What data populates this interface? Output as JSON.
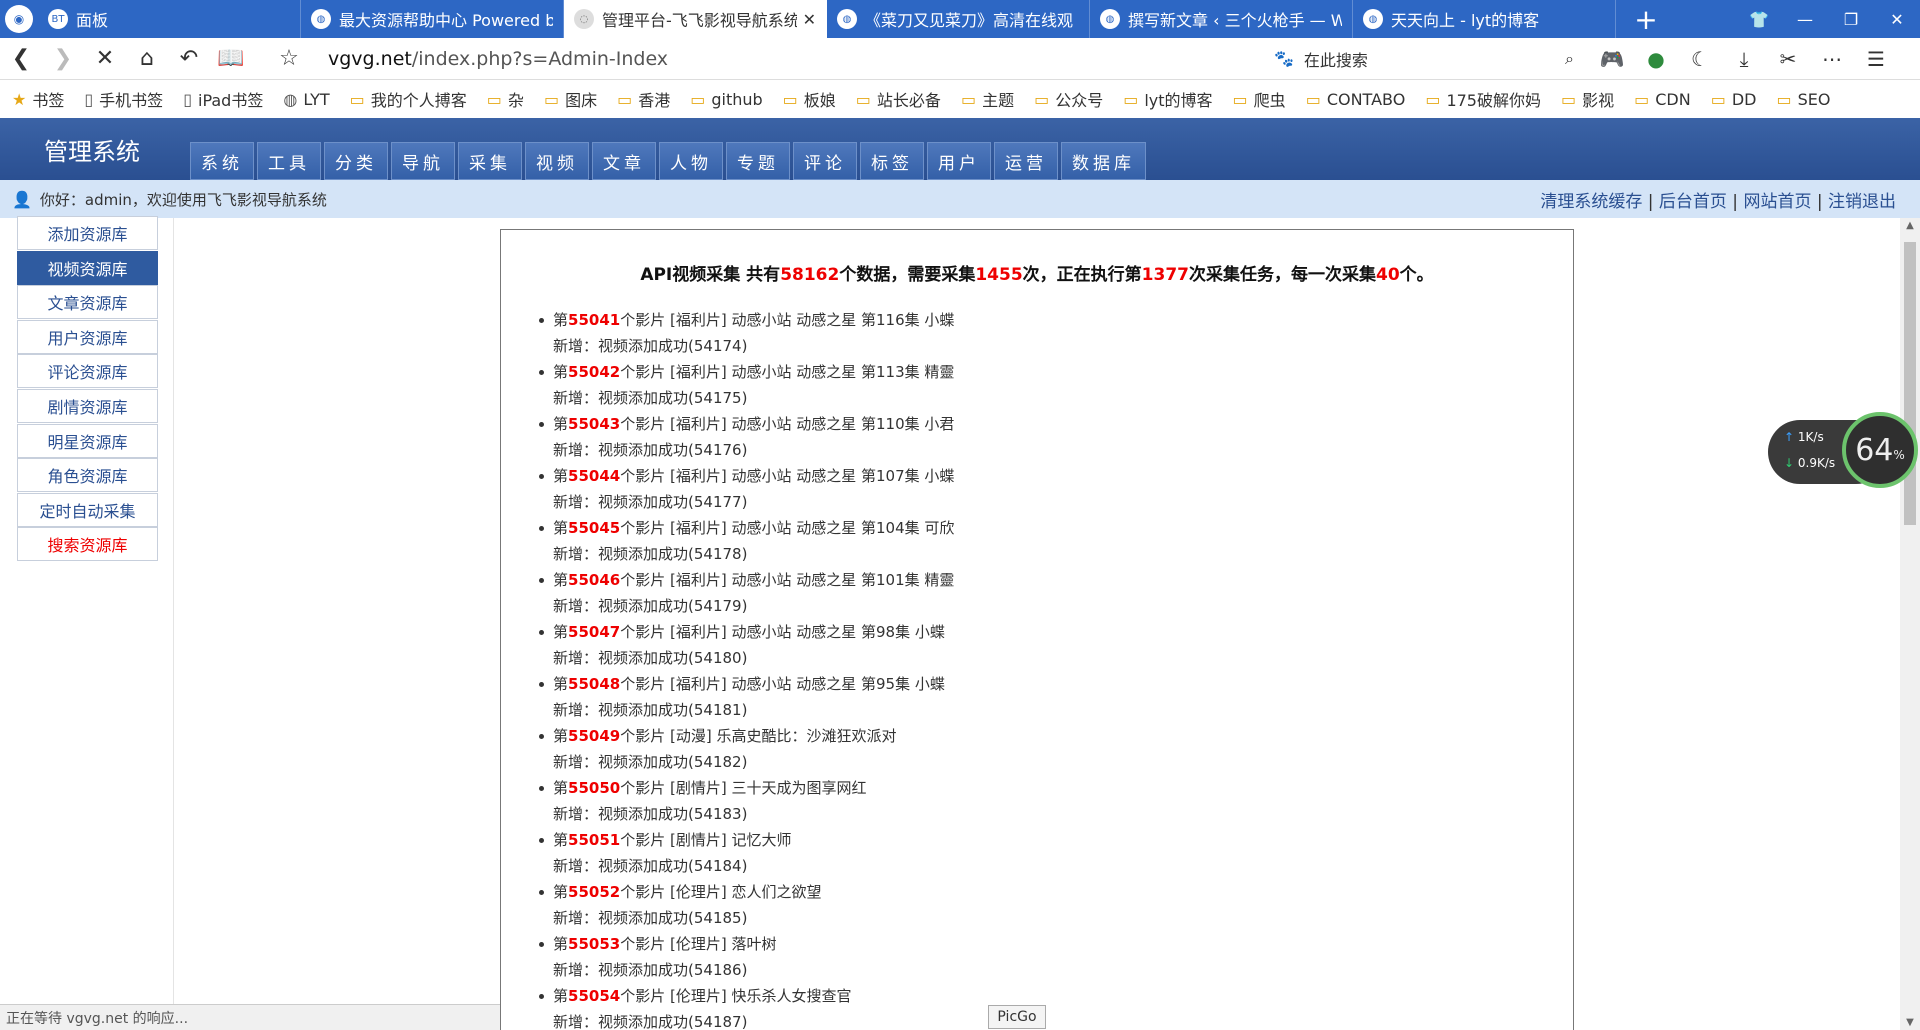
{
  "browser": {
    "tabs": [
      {
        "icon": "BT",
        "title": "面板",
        "active": false
      },
      {
        "icon": "globe-icon",
        "title": "最大资源帮助中心 Powered b",
        "active": false
      },
      {
        "icon": "loading-icon",
        "title": "管理平台-飞飞影视导航系统",
        "active": true
      },
      {
        "icon": "video-icon",
        "title": "《菜刀又见菜刀》高清在线观",
        "active": false
      },
      {
        "icon": "wordpress-icon",
        "title": "撰写新文章 ‹ 三个火枪手 — W",
        "active": false
      },
      {
        "icon": "site-icon",
        "title": "天天向上 - lyt的博客",
        "active": false
      }
    ],
    "new_tab": "+",
    "url_domain": "vgvg.net",
    "url_path": "/index.php?s=Admin-Index",
    "search_placeholder": "在此搜索",
    "bookmarks": [
      {
        "icon": "star-icon",
        "label": "书签"
      },
      {
        "icon": "phone-icon",
        "label": "手机书签"
      },
      {
        "icon": "tablet-icon",
        "label": "iPad书签"
      },
      {
        "icon": "globe-icon",
        "label": "LYT"
      },
      {
        "icon": "folder-icon",
        "label": "我的个人搏客"
      },
      {
        "icon": "folder-icon",
        "label": "杂"
      },
      {
        "icon": "folder-icon",
        "label": "图床"
      },
      {
        "icon": "folder-icon",
        "label": "香港"
      },
      {
        "icon": "folder-icon",
        "label": "github"
      },
      {
        "icon": "folder-icon",
        "label": "板娘"
      },
      {
        "icon": "folder-icon",
        "label": "站长必备"
      },
      {
        "icon": "folder-icon",
        "label": "主题"
      },
      {
        "icon": "folder-icon",
        "label": "公众号"
      },
      {
        "icon": "folder-icon",
        "label": "lyt的博客"
      },
      {
        "icon": "folder-icon",
        "label": "爬虫"
      },
      {
        "icon": "folder-icon",
        "label": "CONTABO"
      },
      {
        "icon": "folder-icon",
        "label": "175破解你妈"
      },
      {
        "icon": "folder-icon",
        "label": "影视"
      },
      {
        "icon": "folder-icon",
        "label": "CDN"
      },
      {
        "icon": "folder-icon",
        "label": "DD"
      },
      {
        "icon": "folder-icon",
        "label": "SEO"
      }
    ],
    "status_text": "正在等待 vgvg.net 的响应...",
    "picgo": "PicGo",
    "net_up": "1K/s",
    "net_down": "0.9K/s",
    "cpu_percent": "64",
    "cpu_unit": "%"
  },
  "admin": {
    "title": "管理系统",
    "nav": [
      "系统",
      "工具",
      "分类",
      "导航",
      "采集",
      "视频",
      "文章",
      "人物",
      "专题",
      "评论",
      "标签",
      "用户",
      "运营",
      "数据库"
    ],
    "welcome": "你好：admin，欢迎使用飞飞影视导航系统",
    "top_links": [
      "清理系统缓存",
      "后台首页",
      "网站首页",
      "注销退出"
    ],
    "sidebar": [
      {
        "label": "添加资源库",
        "active": false,
        "red": false
      },
      {
        "label": "视频资源库",
        "active": true,
        "red": false
      },
      {
        "label": "文章资源库",
        "active": false,
        "red": false
      },
      {
        "label": "用户资源库",
        "active": false,
        "red": false
      },
      {
        "label": "评论资源库",
        "active": false,
        "red": false
      },
      {
        "label": "剧情资源库",
        "active": false,
        "red": false
      },
      {
        "label": "明星资源库",
        "active": false,
        "red": false
      },
      {
        "label": "角色资源库",
        "active": false,
        "red": false
      },
      {
        "label": "定时自动采集",
        "active": false,
        "red": false
      },
      {
        "label": "搜索资源库",
        "active": false,
        "red": true
      }
    ]
  },
  "collect": {
    "title_parts": {
      "prefix": "API视频采集 共有",
      "total": "58162",
      "mid1": "个数据，需要采集",
      "times": "1455",
      "mid2": "次，正在执行第",
      "current": "1377",
      "mid3": "次采集任务，每一次采集",
      "per": "40",
      "suffix": "个。"
    },
    "item_prefix": "第",
    "item_suffix": "个影片",
    "sub_prefix": "新增：视频添加成功",
    "items": [
      {
        "num": "55041",
        "text": " [福利片] 动感小站 动感之星 第116集 小蝶",
        "id": "(54174)"
      },
      {
        "num": "55042",
        "text": " [福利片] 动感小站 动感之星 第113集 精靈",
        "id": "(54175)"
      },
      {
        "num": "55043",
        "text": " [福利片] 动感小站 动感之星 第110集 小君",
        "id": "(54176)"
      },
      {
        "num": "55044",
        "text": " [福利片] 动感小站 动感之星 第107集 小蝶",
        "id": "(54177)"
      },
      {
        "num": "55045",
        "text": " [福利片] 动感小站 动感之星 第104集 可欣",
        "id": "(54178)"
      },
      {
        "num": "55046",
        "text": " [福利片] 动感小站 动感之星 第101集 精靈",
        "id": "(54179)"
      },
      {
        "num": "55047",
        "text": " [福利片] 动感小站 动感之星 第98集 小蝶",
        "id": "(54180)"
      },
      {
        "num": "55048",
        "text": " [福利片] 动感小站 动感之星 第95集 小蝶",
        "id": "(54181)"
      },
      {
        "num": "55049",
        "text": " [动漫] 乐高史酷比：沙滩狂欢派对",
        "id": "(54182)"
      },
      {
        "num": "55050",
        "text": " [剧情片] 三十天成为图享网红",
        "id": "(54183)"
      },
      {
        "num": "55051",
        "text": " [剧情片] 记忆大师",
        "id": "(54184)"
      },
      {
        "num": "55052",
        "text": " [伦理片] 恋人们之欲望",
        "id": "(54185)"
      },
      {
        "num": "55053",
        "text": " [伦理片] 落叶树",
        "id": "(54186)"
      },
      {
        "num": "55054",
        "text": " [伦理片] 快乐杀人女搜查官",
        "id": "(54187)"
      }
    ]
  }
}
